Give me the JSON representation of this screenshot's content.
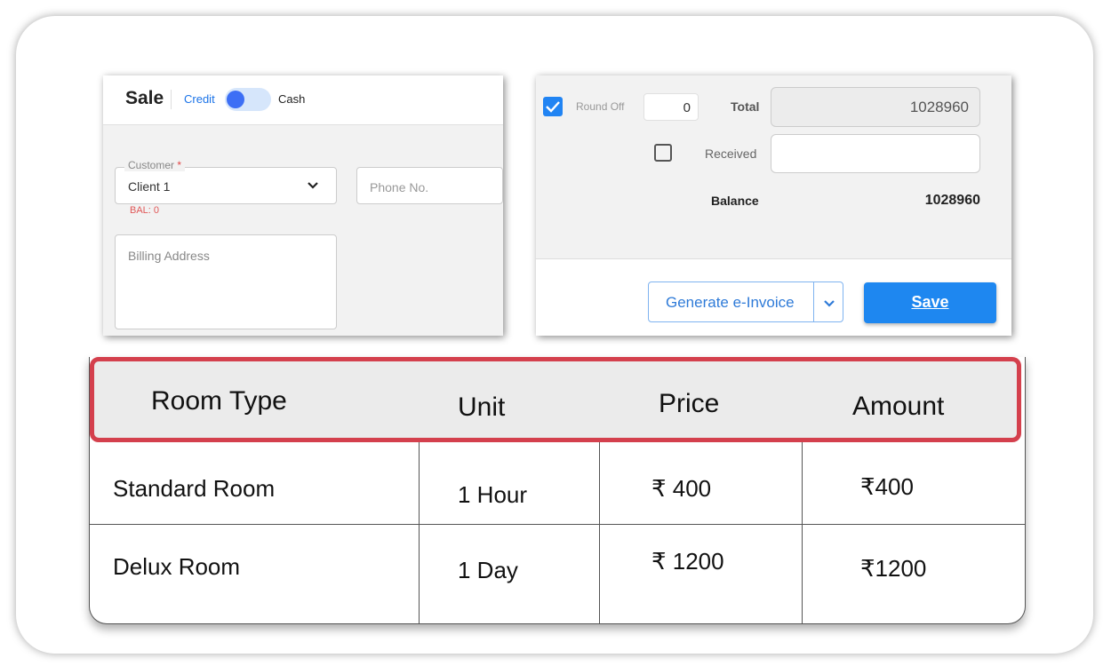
{
  "sale_panel": {
    "title": "Sale",
    "toggle": {
      "left_label": "Credit",
      "right_label": "Cash",
      "state": "credit"
    },
    "customer": {
      "label": "Customer",
      "required_mark": "*",
      "value": "Client 1",
      "balance": "BAL: 0"
    },
    "phone": {
      "placeholder": "Phone No."
    },
    "billing": {
      "placeholder": "Billing Address"
    }
  },
  "totals_panel": {
    "round_off": {
      "label": "Round Off",
      "checked": true,
      "value": "0"
    },
    "total": {
      "label": "Total",
      "value": "1028960"
    },
    "received": {
      "label": "Received",
      "checked": false,
      "value": ""
    },
    "balance": {
      "label": "Balance",
      "value": "1028960"
    },
    "buttons": {
      "generate_einvoice": "Generate e-Invoice",
      "save": "Save"
    }
  },
  "table": {
    "headers": [
      "Room Type",
      "Unit",
      "Price",
      "Amount"
    ],
    "rows": [
      {
        "room_type": "Standard Room",
        "unit": "1 Hour",
        "price": "₹  400",
        "amount": "₹400"
      },
      {
        "room_type": "Delux Room",
        "unit": "1 Day",
        "price": "₹ 1200",
        "amount": "₹1200"
      }
    ]
  },
  "colors": {
    "accent_blue": "#1e87f0",
    "highlight_red": "#d4404d",
    "balance_red": "#e05858"
  }
}
